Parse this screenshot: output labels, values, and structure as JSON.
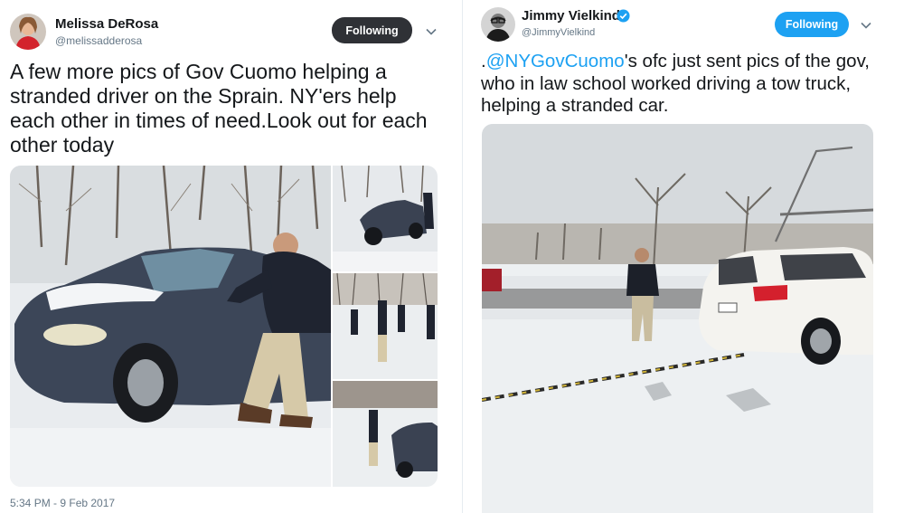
{
  "left_tweet": {
    "author": {
      "name": "Melissa DeRosa",
      "handle": "@melissadderosa"
    },
    "follow_button": {
      "label": "Following",
      "bg": "#2f3136",
      "fg": "#ffffff"
    },
    "text": "A few more pics of Gov Cuomo helping a stranded driver on the Sprain. NY'ers help each other in times of need.Look out for each other today",
    "media": {
      "photos": [
        {
          "name": "cuomo-pushing-car-photo",
          "icon": "photo"
        },
        {
          "name": "car-in-snow-photo",
          "icon": "photo"
        },
        {
          "name": "people-on-road-photo",
          "icon": "photo"
        },
        {
          "name": "cuomo-walking-photo",
          "icon": "photo"
        }
      ]
    },
    "timestamp": "5:34 PM - 9 Feb 2017"
  },
  "right_tweet": {
    "author": {
      "name": "Jimmy Vielkind",
      "handle": "@JimmyVielkind",
      "verified": true
    },
    "follow_button": {
      "label": "Following",
      "bg": "#1da1f2",
      "fg": "#ffffff"
    },
    "text_prefix": ".",
    "mention": "@NYGovCuomo",
    "text_rest": "'s ofc just sent pics of the gov, who in law school worked driving a tow truck, helping a stranded car.",
    "media": {
      "name": "tow-strap-car-photo",
      "icon": "photo"
    }
  },
  "colors": {
    "accent": "#1da1f2",
    "text": "#14171a",
    "muted": "#657786"
  }
}
